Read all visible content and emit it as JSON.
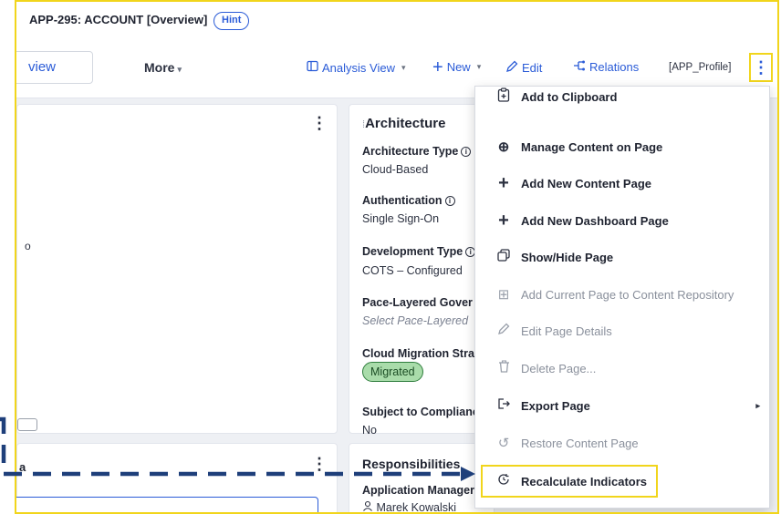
{
  "header": {
    "app_title": "APP-295: ACCOUNT [Overview]",
    "hint_label": "Hint"
  },
  "toolbar": {
    "view_tab_label": "view",
    "more_label": "More",
    "analysis_view_label": "Analysis View",
    "new_label": "New",
    "edit_label": "Edit",
    "relations_label": "Relations",
    "profile_label": "[APP_Profile]",
    "kebab_icon": "⋮"
  },
  "left_card": {
    "kebab": "⋮",
    "fragment_char": "o"
  },
  "architecture_card": {
    "title": "Architecture",
    "fields": [
      {
        "label": "Architecture Type",
        "value": "Cloud-Based"
      },
      {
        "label": "Authentication",
        "value": "Single Sign-On"
      },
      {
        "label": "Development Type",
        "value": "COTS – Configured"
      },
      {
        "label": "Pace-Layered Gover",
        "value": "Select Pace-Layered"
      },
      {
        "label": "Cloud Migration Stra",
        "value": "Migrated"
      },
      {
        "label": "Subject to Complianc",
        "value": "No"
      }
    ]
  },
  "left_bottom_card": {
    "fragment_char": "a",
    "kebab": "⋮"
  },
  "responsibilities_card": {
    "title": "Responsibilities",
    "label": "Application Manager",
    "value": "Marek Kowalski"
  },
  "menu": {
    "items": [
      {
        "label": "Add to Clipboard",
        "icon": "clipboard-plus-icon",
        "disabled": false
      },
      {
        "label": "Manage Content on Page",
        "icon": "circle-plus-icon",
        "disabled": false
      },
      {
        "label": "Add New Content Page",
        "icon": "plus-icon",
        "disabled": false
      },
      {
        "label": "Add New Dashboard Page",
        "icon": "plus-icon",
        "disabled": false
      },
      {
        "label": "Show/Hide Page",
        "icon": "layers-icon",
        "disabled": false
      },
      {
        "label": "Add Current Page to Content Repository",
        "icon": "square-plus-icon",
        "disabled": true
      },
      {
        "label": "Edit Page Details",
        "icon": "pencil-icon",
        "disabled": true
      },
      {
        "label": "Delete Page...",
        "icon": "trash-icon",
        "disabled": true
      },
      {
        "label": "Export Page",
        "icon": "export-icon",
        "disabled": false,
        "submenu": true
      },
      {
        "label": "Restore Content Page",
        "icon": "restore-icon",
        "disabled": true
      },
      {
        "label": "Recalculate Indicators",
        "icon": "clock-refresh-icon",
        "disabled": false
      }
    ]
  },
  "colors": {
    "accent": "#2a5bd7",
    "highlight": "#f1d51c",
    "arrow": "#1e3f7a",
    "pill_bg": "#a9dcaa"
  }
}
